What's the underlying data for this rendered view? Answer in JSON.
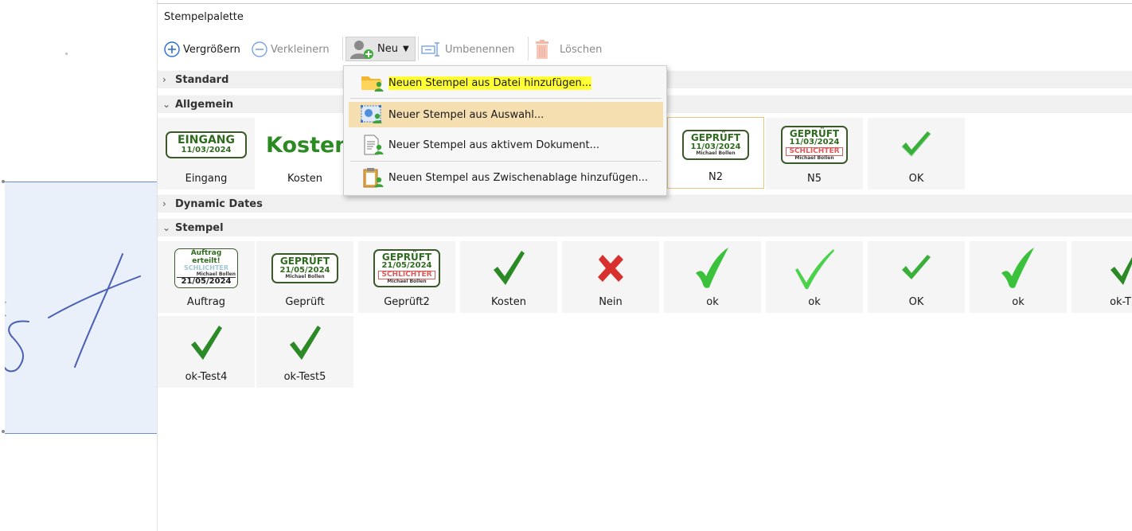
{
  "panel": {
    "title": "Stempelpalette"
  },
  "toolbar": {
    "enlarge_label": "Vergrößern",
    "shrink_label": "Verkleinern",
    "new_label": "Neu",
    "rename_label": "Umbenennen",
    "delete_label": "Löschen"
  },
  "sections": {
    "standard": "Standard",
    "allgemein": "Allgemein",
    "dynamic_dates": "Dynamic Dates",
    "stempel": "Stempel"
  },
  "allgemein_stamps": {
    "eingang_title": "EINGANG",
    "eingang_date": "11/03/2024",
    "eingang_label": "Eingang",
    "kosten_text": "Kosten",
    "kosten_label": "Kosten",
    "n2_title": "GEPRÜFT",
    "n2_date": "11/03/2024",
    "n2_sig": "Michael Bollen",
    "n2_label": "N2",
    "n5_title": "GEPRÜFT",
    "n5_date": "11/03/2024",
    "n5_red": "SCHLICHTER",
    "n5_sig": "Michael Bollen",
    "n5_label": "N5",
    "ok_label": "OK"
  },
  "stempel_stamps": {
    "auftrag_title": "Auftrag erteilt!",
    "auftrag_faded": "SCHLICHTER",
    "auftrag_sig": "Michael Bollen",
    "auftrag_date": "21/05/2024",
    "auftrag_label": "Auftrag",
    "gepruft_title": "GEPRÜFT",
    "gepruft_date": "21/05/2024",
    "gepruft_sig": "Michael Bollen",
    "gepruft_label": "Geprüft",
    "gepruft2_title": "GEPRÜFT",
    "gepruft2_date": "21/05/2024",
    "gepruft2_red": "SCHLICHTER",
    "gepruft2_sig": "Michael Bollen",
    "gepruft2_label": "Geprüft2",
    "kosten_label": "Kosten",
    "nein_label": "Nein",
    "ok1_label": "ok",
    "ok2_label": "ok",
    "ok3_label": "OK",
    "ok4_label": "ok",
    "ok_t_label": "ok-T",
    "ok_test4_label": "ok-Test4",
    "ok_test5_label": "ok-Test5"
  },
  "menu": {
    "from_file": "Neuen Stempel aus Datei hinzufügen...",
    "from_selection": "Neuer Stempel aus Auswahl...",
    "from_document": "Neuer Stempel aus aktivem Dokument...",
    "from_clipboard": "Neuen Stempel aus Zwischenablage hinzufügen..."
  },
  "colors": {
    "highlight_yellow": "#ffff33",
    "hover_tan": "#f5deb0",
    "check_green": "#3cc13c",
    "stamp_green": "#2f6b1f",
    "stamp_red": "#e05a5a",
    "selected_border": "#e6c77d",
    "ink_blue": "#4a5fb5"
  },
  "icons": {
    "enlarge": "plus-circle-icon",
    "shrink": "minus-circle-icon",
    "new": "user-add-icon",
    "rename": "rename-icon",
    "delete": "trash-icon",
    "chevron": "chevron-icon"
  }
}
